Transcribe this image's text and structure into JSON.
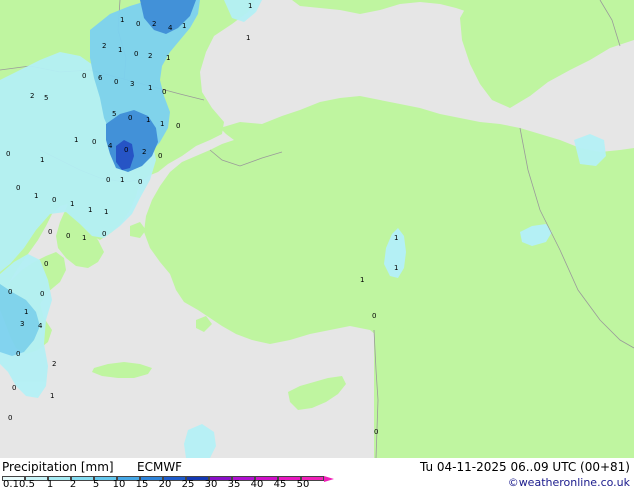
{
  "colors": {
    "sea": "#e6e6e6",
    "land": "#bff5a0",
    "border": "#9a9a9a",
    "precip_light": "#b4f0f5",
    "precip_mid": "#7dd2f0",
    "precip_heavy": "#3c8cdc",
    "precip_core": "#1e4cc8"
  },
  "footer": {
    "title": "Precipitation [mm]",
    "model": "ECMWF",
    "datetime": "Tu 04-11-2025 06..09 UTC (00+81)",
    "credit": "©weatheronline.co.uk"
  },
  "legend": {
    "labels": [
      "0.1",
      "0.5",
      "1",
      "2",
      "5",
      "10",
      "15",
      "20",
      "25",
      "30",
      "35",
      "40",
      "45",
      "50"
    ],
    "colors": [
      "#e8fbfc",
      "#c8f4f8",
      "#a6ecf4",
      "#84ddf2",
      "#64c8ee",
      "#46a8e6",
      "#2e84da",
      "#1e5ccc",
      "#1438b4",
      "#8a10c8",
      "#b010d0",
      "#d010c8",
      "#e818c0",
      "#f020b8"
    ]
  },
  "point_values": [
    "1",
    "0",
    "2",
    "4",
    "1",
    "1",
    "1",
    "2",
    "1",
    "0",
    "2",
    "1",
    "0",
    "6",
    "0",
    "3",
    "1",
    "0",
    "5",
    "2",
    "5",
    "0",
    "1",
    "1",
    "0",
    "4",
    "0",
    "2",
    "0",
    "1",
    "0",
    "0",
    "1",
    "1",
    "0",
    "0",
    "0",
    "1",
    "0",
    "1",
    "1",
    "1",
    "0",
    "0",
    "0",
    "1",
    "0",
    "0",
    "0",
    "1",
    "3",
    "4",
    "0",
    "2",
    "0",
    "1",
    "0",
    "0",
    "1",
    "1",
    "1",
    "0"
  ]
}
